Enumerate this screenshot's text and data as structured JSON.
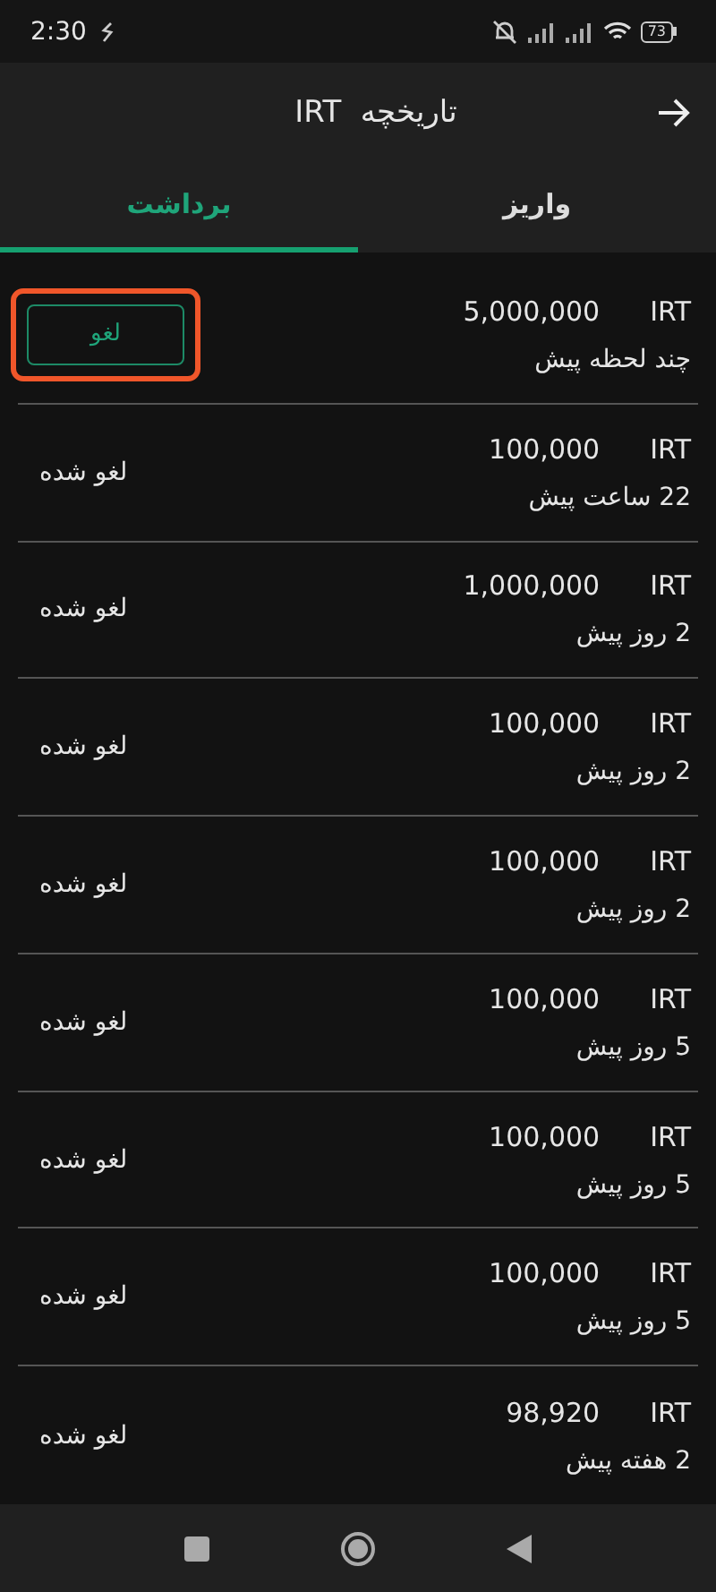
{
  "status_bar": {
    "time": "2:30",
    "battery": "73"
  },
  "app_bar": {
    "title": "تاریخچه  IRT"
  },
  "tabs": [
    {
      "label": "واریز",
      "selected": false
    },
    {
      "label": "برداشت",
      "selected": true
    }
  ],
  "transactions": [
    {
      "currency": "IRT",
      "amount": "5,000,000",
      "time": "چند لحظه پیش",
      "kind": "cancel_button",
      "status": "لغو",
      "highlighted": true
    },
    {
      "currency": "IRT",
      "amount": "100,000",
      "time": "22 ساعت پیش",
      "kind": "canceled",
      "status": "لغو شده",
      "highlighted": false
    },
    {
      "currency": "IRT",
      "amount": "1,000,000",
      "time": "2 روز پیش",
      "kind": "canceled",
      "status": "لغو شده",
      "highlighted": false
    },
    {
      "currency": "IRT",
      "amount": "100,000",
      "time": "2 روز پیش",
      "kind": "canceled",
      "status": "لغو شده",
      "highlighted": false
    },
    {
      "currency": "IRT",
      "amount": "100,000",
      "time": "2 روز پیش",
      "kind": "canceled",
      "status": "لغو شده",
      "highlighted": false
    },
    {
      "currency": "IRT",
      "amount": "100,000",
      "time": "5 روز پیش",
      "kind": "canceled",
      "status": "لغو شده",
      "highlighted": false
    },
    {
      "currency": "IRT",
      "amount": "100,000",
      "time": "5 روز پیش",
      "kind": "canceled",
      "status": "لغو شده",
      "highlighted": false
    },
    {
      "currency": "IRT",
      "amount": "100,000",
      "time": "5 روز پیش",
      "kind": "canceled",
      "status": "لغو شده",
      "highlighted": false
    },
    {
      "currency": "IRT",
      "amount": "98,920",
      "time": "2 هفته پیش",
      "kind": "canceled",
      "status": "لغو شده",
      "highlighted": false
    }
  ]
}
